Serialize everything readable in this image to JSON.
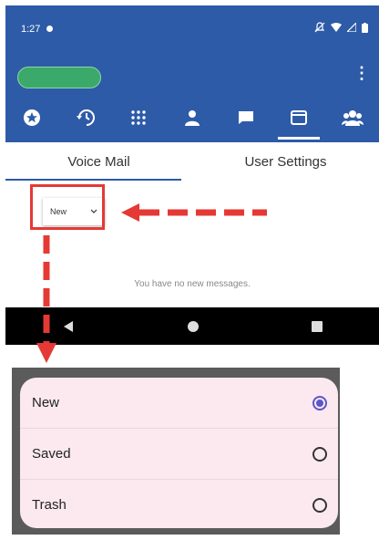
{
  "status": {
    "time": "1:27"
  },
  "tabs": [
    {
      "label": "Voice Mail",
      "active": true
    },
    {
      "label": "User Settings",
      "active": false
    }
  ],
  "nav_icons": [
    "favorites-icon",
    "recents-icon",
    "dialpad-icon",
    "contacts-icon",
    "chat-icon",
    "voicemail-icon",
    "groups-icon"
  ],
  "filter": {
    "selected": "New"
  },
  "empty_message": "You have no new messages.",
  "options": [
    {
      "label": "New",
      "selected": true
    },
    {
      "label": "Saved",
      "selected": false
    },
    {
      "label": "Trash",
      "selected": false
    }
  ],
  "colors": {
    "brand": "#2d5ba8",
    "highlight": "#e53935",
    "radio_selected": "#5b57c9"
  }
}
